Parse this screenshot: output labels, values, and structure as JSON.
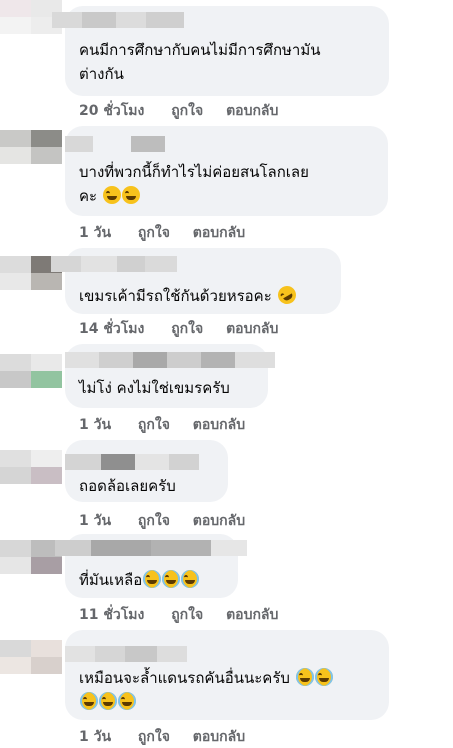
{
  "comments": [
    {
      "text": "คนมีการศึกษากับคนไม่มีการศึกษามัน\nต่างกัน",
      "emojis": [],
      "time": "20 ชั่วโมง"
    },
    {
      "text": "บางที่พวกนี้ก็ทำไรไม่ค่อยสนโลกเลย\nคะ",
      "emojis": [
        "grin-sweat-icon",
        "grin-sweat-icon"
      ],
      "time": "1 วัน"
    },
    {
      "text": "เขมรเค้ามีรถใช้กันด้วยหรอคะ",
      "emojis": [
        "rofl-icon"
      ],
      "time": "14 ชั่วโมง"
    },
    {
      "text": "ไม่โง่ คงไม่ใช่เขมรครับ",
      "emojis": [],
      "time": "1 วัน"
    },
    {
      "text": "ถอดล้อเลยครับ",
      "emojis": [],
      "time": "1 วัน"
    },
    {
      "text": "ที่มันเหลือ",
      "emojis": [
        "joy-icon",
        "joy-icon",
        "joy-icon"
      ],
      "time": "11 ชั่วโมง"
    },
    {
      "text": "เหมือนจะล้ำแดนรถคันอื่นนะครับ",
      "emojis": [
        "joy-icon",
        "joy-icon",
        "joy-icon",
        "joy-icon",
        "joy-icon"
      ],
      "time": "1 วัน"
    }
  ],
  "actions": {
    "like": "ถูกใจ",
    "reply": "ตอบกลับ"
  },
  "colors": {
    "bubble": "#f0f2f5",
    "meta": "#65676b",
    "text": "#050505",
    "emoji": "#f7c21c"
  }
}
